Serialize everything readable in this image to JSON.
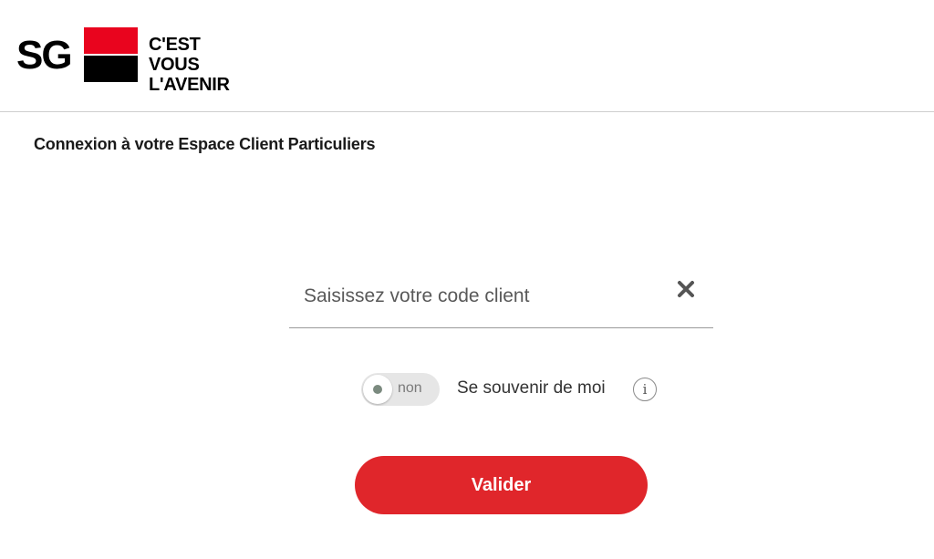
{
  "brand": {
    "logo_text": "SG",
    "tagline": "C'EST VOUS\nL'AVENIR",
    "colors": {
      "red": "#e9041e",
      "black": "#000000"
    }
  },
  "page": {
    "title": "Connexion à votre Espace Client Particuliers"
  },
  "login_form": {
    "client_code": {
      "value": "",
      "placeholder": "Saisissez votre code client",
      "clear_icon": "close-icon"
    },
    "remember_me": {
      "state_label": "non",
      "checked": false,
      "label": "Se souvenir de moi",
      "info_icon": "info-icon",
      "info_glyph": "i"
    },
    "submit_label": "Valider",
    "accent_color": "#e0262b"
  }
}
